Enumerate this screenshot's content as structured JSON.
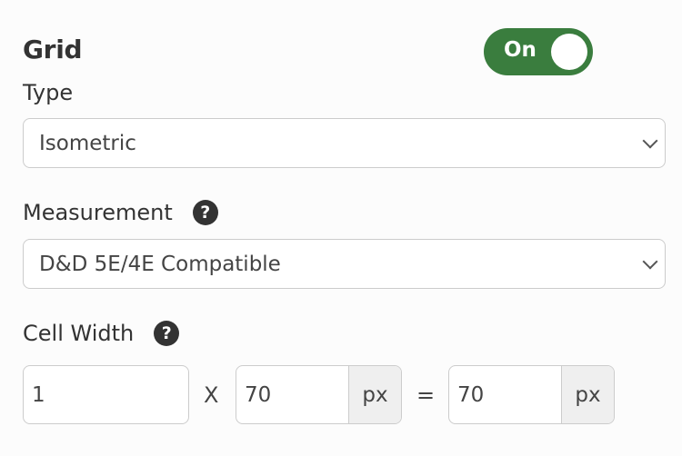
{
  "grid": {
    "title": "Grid",
    "toggle": {
      "label": "On",
      "state": true,
      "color": "#3a7d3e"
    }
  },
  "type": {
    "label": "Type",
    "selected": "Isometric"
  },
  "measurement": {
    "label": "Measurement",
    "help_glyph": "?",
    "selected": "D&D 5E/4E Compatible"
  },
  "cell_width": {
    "label": "Cell Width",
    "help_glyph": "?",
    "multiplier": "1",
    "times_symbol": "X",
    "pixels": "70",
    "pixels_unit": "px",
    "equals_symbol": "=",
    "result": "70",
    "result_unit": "px"
  }
}
